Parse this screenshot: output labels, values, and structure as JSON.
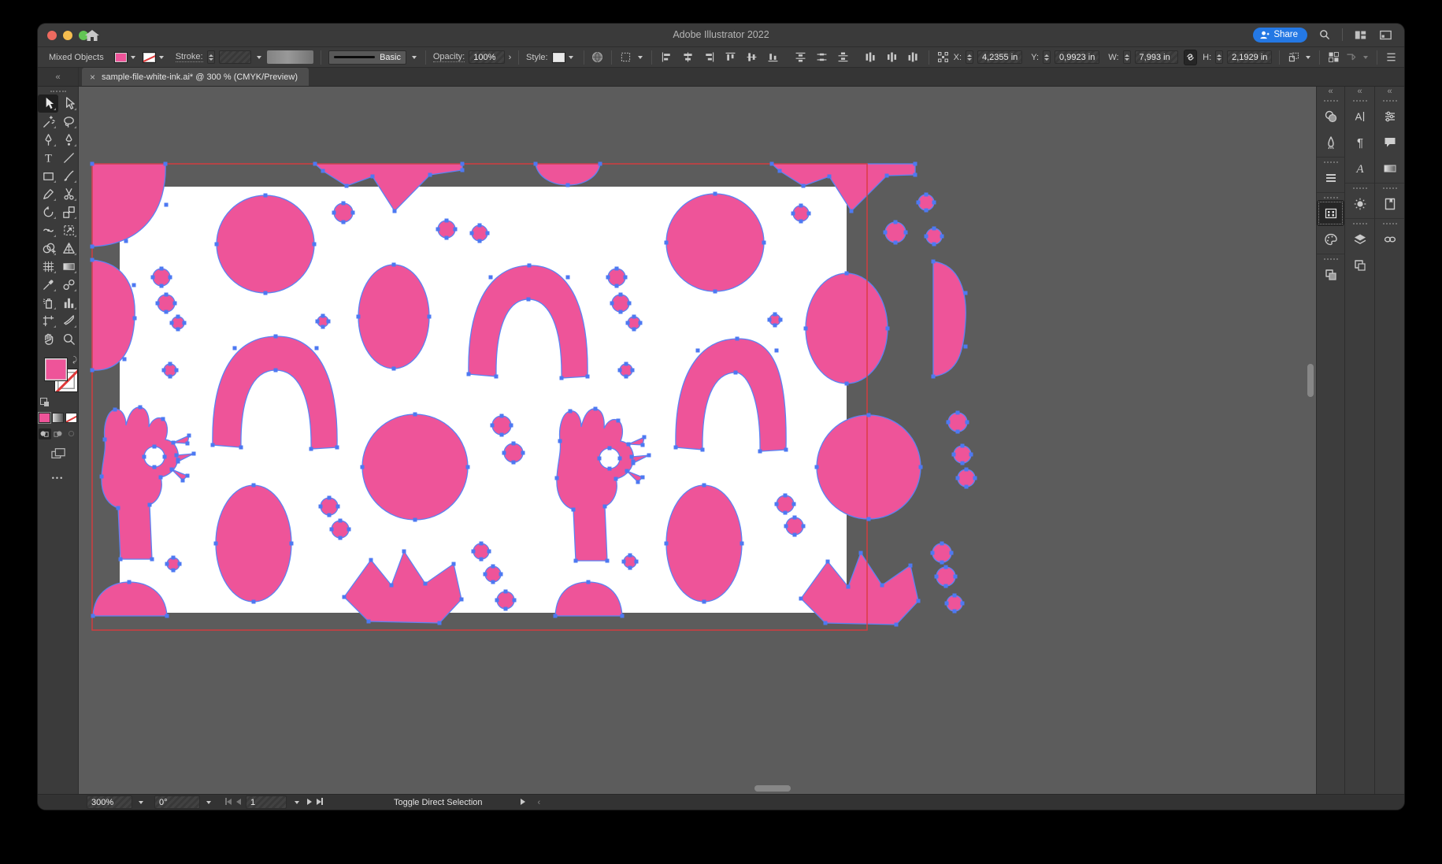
{
  "window": {
    "title": "Adobe Illustrator 2022"
  },
  "titlebar": {
    "share_label": "Share"
  },
  "control_bar": {
    "selection_label": "Mixed Objects",
    "stroke_label": "Stroke:",
    "brush_label": "Basic",
    "opacity_label": "Opacity:",
    "opacity_value": "100%",
    "style_label": "Style:",
    "x_label": "X:",
    "x_value": "4,2355 in",
    "y_label": "Y:",
    "y_value": "0,9923 in",
    "w_label": "W:",
    "w_value": "7,993 in",
    "h_label": "H:",
    "h_value": "2,1929 in"
  },
  "document_tab": {
    "close": "×",
    "title": "sample-file-white-ink.ai* @ 300 % (CMYK/Preview)"
  },
  "toolbar": {
    "tools": [
      {
        "name": "selection",
        "active": true
      },
      {
        "name": "direct-selection",
        "active": false
      },
      {
        "name": "magic-wand",
        "active": false
      },
      {
        "name": "lasso",
        "active": false
      },
      {
        "name": "pen",
        "active": false
      },
      {
        "name": "curvature",
        "active": false
      },
      {
        "name": "type",
        "active": false
      },
      {
        "name": "line-segment",
        "active": false
      },
      {
        "name": "rectangle",
        "active": false
      },
      {
        "name": "paintbrush",
        "active": false
      },
      {
        "name": "pencil",
        "active": false
      },
      {
        "name": "scissors",
        "active": false
      },
      {
        "name": "rotate",
        "active": false
      },
      {
        "name": "scale",
        "active": false
      },
      {
        "name": "width-tool",
        "active": false
      },
      {
        "name": "free-transform",
        "active": false
      },
      {
        "name": "shape-builder",
        "active": false
      },
      {
        "name": "perspective-grid",
        "active": false
      },
      {
        "name": "mesh",
        "active": false
      },
      {
        "name": "gradient",
        "active": false
      },
      {
        "name": "eyedropper",
        "active": false
      },
      {
        "name": "blend",
        "active": false
      },
      {
        "name": "symbol-sprayer",
        "active": false
      },
      {
        "name": "column-graph",
        "active": false
      },
      {
        "name": "artboard",
        "active": false
      },
      {
        "name": "slice",
        "active": false
      },
      {
        "name": "hand",
        "active": false
      },
      {
        "name": "zoom",
        "active": false
      }
    ],
    "collapse_glyph": "«"
  },
  "right_panels": {
    "collapse_glyph": "«",
    "strips": [
      {
        "name": "strip-a",
        "groups": [
          [
            "swatches",
            "brushes"
          ],
          [
            "stroke"
          ],
          [
            "pattern-options",
            "color-themes"
          ],
          [
            "transparency"
          ]
        ],
        "active": "pattern-options"
      },
      {
        "name": "strip-b",
        "groups": [
          [
            "character",
            "paragraph",
            "glyphs"
          ],
          [
            "color"
          ],
          [
            "layers",
            "artboards"
          ]
        ],
        "active": ""
      },
      {
        "name": "strip-c",
        "groups": [
          [
            "properties",
            "comments",
            "gradient"
          ],
          [
            "libraries"
          ],
          [
            "links"
          ]
        ],
        "active": ""
      }
    ]
  },
  "status_bar": {
    "zoom_value": "300%",
    "rotation_value": "0°",
    "artboard_number": "1",
    "status_text": "Toggle Direct Selection"
  },
  "colors": {
    "pink": "#ee5499",
    "selection_blue": "#5b83f4",
    "anchor_blue": "#4d79f2",
    "tile_red": "#d93a3e",
    "artboard_white": "#ffffff",
    "pasteboard_gray": "#5c5c5c",
    "accent_share_blue": "#2478e4",
    "traffic_red": "#ee6a5f",
    "traffic_yellow": "#f5bd4f",
    "traffic_green": "#62c554"
  }
}
